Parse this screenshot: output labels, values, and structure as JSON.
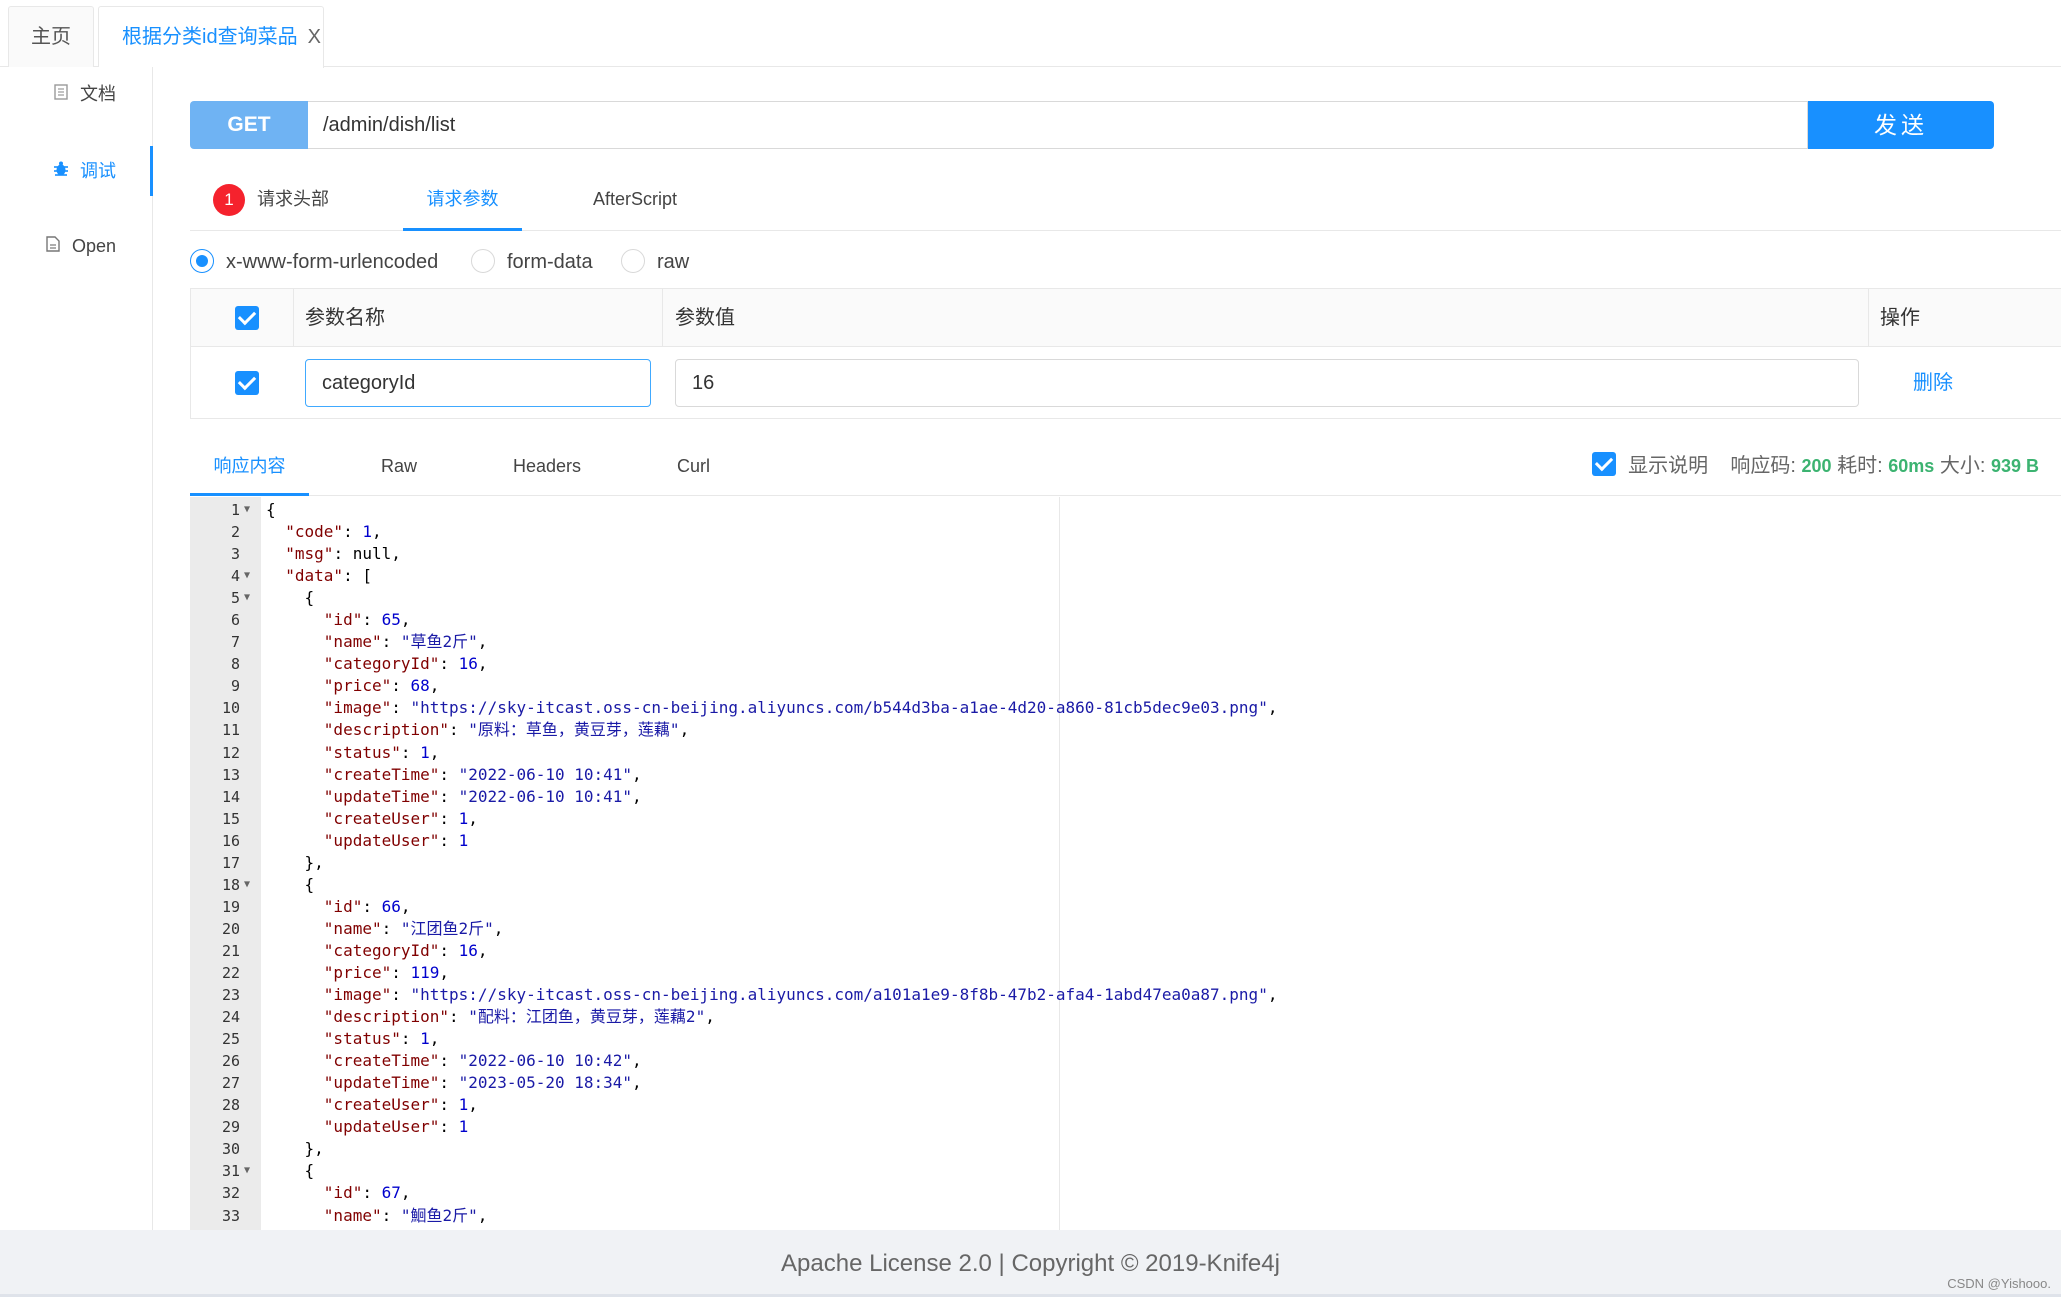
{
  "top_tabs": [
    {
      "label": "主页"
    },
    {
      "label": "根据分类id查询菜品",
      "close": "X"
    }
  ],
  "sidebar": {
    "items": [
      {
        "label": "文档",
        "icon": "document-icon"
      },
      {
        "label": "调试",
        "icon": "bug-icon"
      },
      {
        "label": "Open",
        "icon": "file-icon"
      }
    ]
  },
  "request": {
    "method": "GET",
    "url": "/admin/dish/list",
    "send_label": "发送"
  },
  "request_tabs": {
    "headers_badge": "1",
    "headers_label": "请求头部",
    "params_label": "请求参数",
    "afterscript_label": "AfterScript"
  },
  "body_types": [
    "x-www-form-urlencoded",
    "form-data",
    "raw"
  ],
  "params_table": {
    "headers": [
      "参数名称",
      "参数值",
      "操作"
    ],
    "rows": [
      {
        "name": "categoryId",
        "value": "16",
        "action": "删除"
      }
    ]
  },
  "response": {
    "tabs": [
      "响应内容",
      "Raw",
      "Headers",
      "Curl"
    ],
    "show_desc_label": "显示说明",
    "code_label": "响应码:",
    "code_value": "200",
    "time_label": "耗时:",
    "time_value": "60ms",
    "size_label": "大小:",
    "size_value": "939 B"
  },
  "code_lines": [
    "{",
    "  \"code\": 1,",
    "  \"msg\": null,",
    "  \"data\": [",
    "    {",
    "      \"id\": 65,",
    "      \"name\": \"草鱼2斤\",",
    "      \"categoryId\": 16,",
    "      \"price\": 68,",
    "      \"image\": \"https://sky-itcast.oss-cn-beijing.aliyuncs.com/b544d3ba-a1ae-4d20-a860-81cb5dec9e03.png\",",
    "      \"description\": \"原料：草鱼，黄豆芽，莲藕\",",
    "      \"status\": 1,",
    "      \"createTime\": \"2022-06-10 10:41\",",
    "      \"updateTime\": \"2022-06-10 10:41\",",
    "      \"createUser\": 1,",
    "      \"updateUser\": 1",
    "    },",
    "    {",
    "      \"id\": 66,",
    "      \"name\": \"江团鱼2斤\",",
    "      \"categoryId\": 16,",
    "      \"price\": 119,",
    "      \"image\": \"https://sky-itcast.oss-cn-beijing.aliyuncs.com/a101a1e9-8f8b-47b2-afa4-1abd47ea0a87.png\",",
    "      \"description\": \"配料：江团鱼，黄豆芽，莲藕2\",",
    "      \"status\": 1,",
    "      \"createTime\": \"2022-06-10 10:42\",",
    "      \"updateTime\": \"2023-05-20 18:34\",",
    "      \"createUser\": 1,",
    "      \"updateUser\": 1",
    "    },",
    "    {",
    "      \"id\": 67,",
    "      \"name\": \"鮰鱼2斤\","
  ],
  "fold_lines": [
    1,
    4,
    5,
    18,
    31
  ],
  "footer": {
    "license": "Apache License 2.0 | Copyright © 2019-Knife4j",
    "watermark": "CSDN @Yishooo."
  },
  "colors": {
    "accent": "#1890ff",
    "method_bg": "#6fb3f3",
    "badge": "#f5222d",
    "success": "#3cb371"
  }
}
